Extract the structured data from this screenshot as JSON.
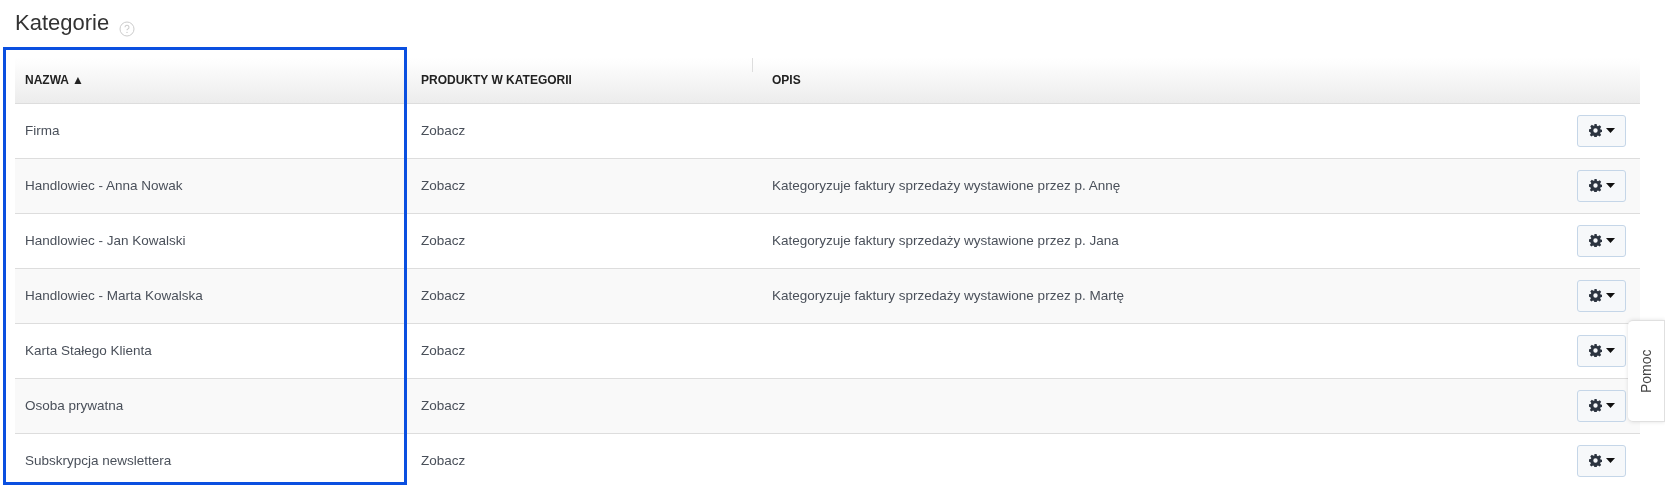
{
  "page": {
    "title": "Kategorie"
  },
  "help_tab": {
    "label": "Pomoc"
  },
  "table": {
    "columns": [
      {
        "label": "NAZWA ▲",
        "highlighted": true
      },
      {
        "label": "PRODUKTY W KATEGORII",
        "highlighted": false
      },
      {
        "label": "OPIS",
        "highlighted": false
      }
    ],
    "rows": [
      {
        "name": "Firma",
        "products": "Zobacz"
      },
      {
        "name": "Handlowiec - Anna Nowak",
        "products": "Zobacz",
        "description": "Kategoryzuje faktury sprzedaży wystawione przez p. Annę"
      },
      {
        "name": "Handlowiec - Jan Kowalski",
        "products": "Zobacz",
        "description": "Kategoryzuje faktury sprzedaży wystawione przez p. Jana"
      },
      {
        "name": "Handlowiec - Marta Kowalska",
        "products": "Zobacz",
        "description": "Kategoryzuje faktury sprzedaży wystawione przez p. Martę"
      },
      {
        "name": "Karta Stałego Klienta",
        "products": "Zobacz"
      },
      {
        "name": "Osoba prywatna",
        "products": "Zobacz"
      },
      {
        "name": "Subskrypcja newslettera",
        "products": "Zobacz"
      }
    ]
  }
}
